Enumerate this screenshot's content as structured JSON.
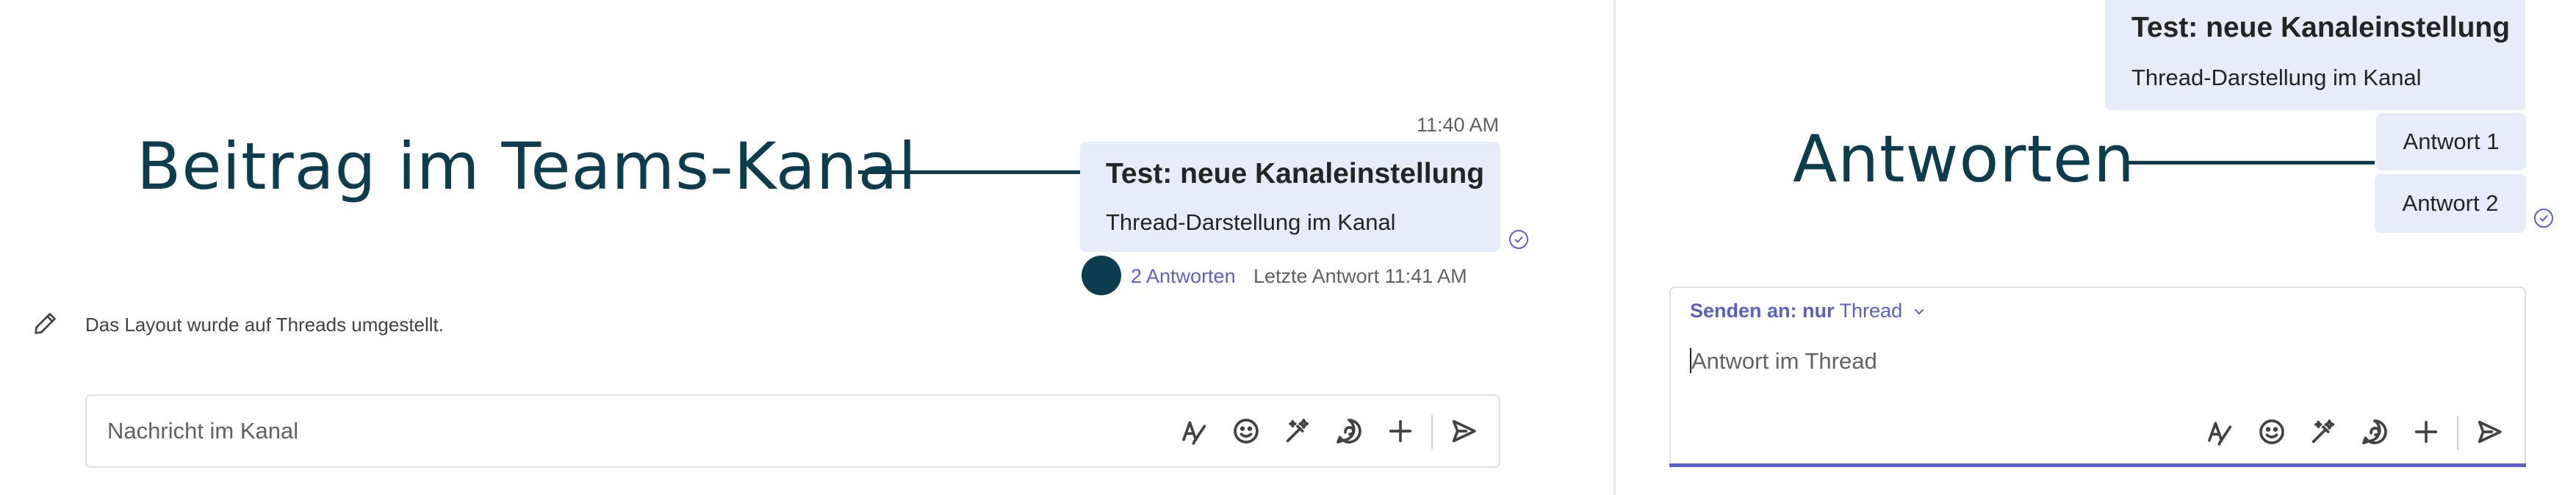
{
  "left": {
    "annotation_title": "Beitrag im Teams-Kanal",
    "timestamp": "11:40 AM",
    "post": {
      "title": "Test: neue Kanaleinstellung",
      "subtitle": "Thread-Darstellung im Kanal"
    },
    "replies": {
      "count_label": "2 Antworten",
      "last_reply": "Letzte Antwort 11:41 AM"
    },
    "system_message": "Das Layout wurde auf Threads umgestellt.",
    "composer": {
      "placeholder": "Nachricht im Kanal"
    }
  },
  "right": {
    "annotation_title": "Antworten",
    "post": {
      "title": "Test: neue Kanaleinstellung",
      "subtitle": "Thread-Darstellung im Kanal"
    },
    "replies": [
      "Antwort 1",
      "Antwort 2"
    ],
    "composer": {
      "send_to_label": "Senden an: nur",
      "send_to_value": "Thread",
      "placeholder": "Antwort im Thread"
    }
  },
  "icons": {
    "toolbar": [
      "format-icon",
      "emoji-icon",
      "copilot-sparkle-icon",
      "loop-icon",
      "plus-icon",
      "send-icon"
    ],
    "edit": "pencil-icon",
    "status": "read-check-icon"
  },
  "colors": {
    "accent": "#5b5fc7",
    "annotation": "#0b3d4f",
    "bubble": "#e8ebfa"
  }
}
